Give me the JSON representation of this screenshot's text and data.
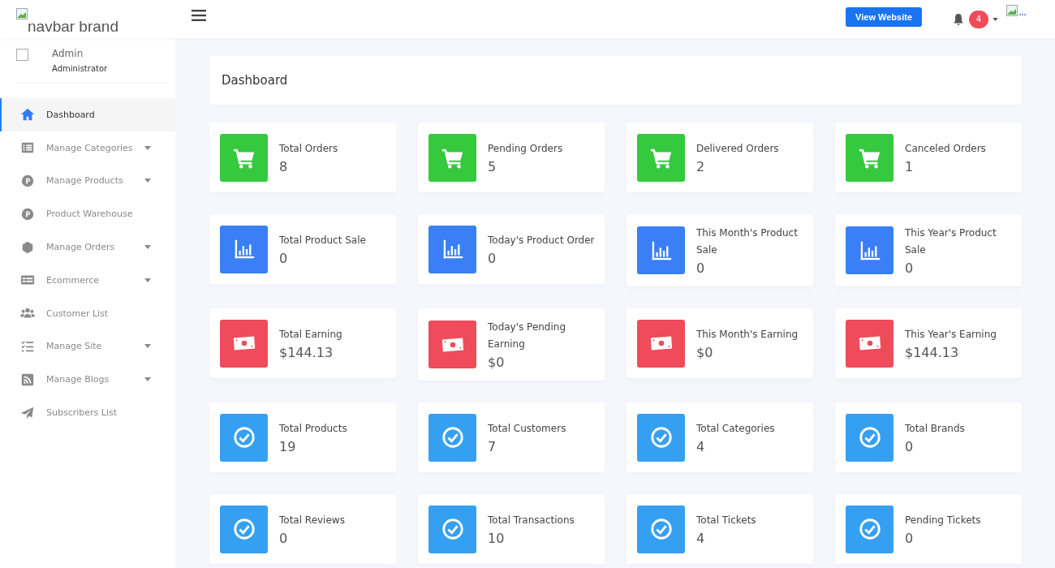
{
  "navbar": {
    "brand": "navbar brand",
    "button": "View Website",
    "notification_count": "4"
  },
  "user": {
    "name": "Admin",
    "role": "Administrator"
  },
  "sidebar": {
    "items": [
      {
        "label": "Dashboard",
        "kind": "home",
        "expandable": false,
        "selected": true
      },
      {
        "label": "Manage Categories",
        "kind": "list",
        "expandable": true,
        "selected": false
      },
      {
        "label": "Manage Products",
        "kind": "p",
        "expandable": true,
        "selected": false
      },
      {
        "label": "Product Warehouse",
        "kind": "p",
        "expandable": false,
        "selected": false
      },
      {
        "label": "Manage Orders",
        "kind": "hex",
        "expandable": true,
        "selected": false
      },
      {
        "label": "Ecommerce",
        "kind": "table",
        "expandable": true,
        "selected": false
      },
      {
        "label": "Customer List",
        "kind": "users",
        "expandable": false,
        "selected": false
      },
      {
        "label": "Manage Site",
        "kind": "tasks",
        "expandable": true,
        "selected": false
      },
      {
        "label": "Manage Blogs",
        "kind": "rss",
        "expandable": true,
        "selected": false
      },
      {
        "label": "Subscribers List",
        "kind": "send",
        "expandable": false,
        "selected": false
      }
    ]
  },
  "page_title": "Dashboard",
  "cards": [
    {
      "kind": "cart",
      "title": "Total Orders",
      "value": "8"
    },
    {
      "kind": "cart",
      "title": "Pending Orders",
      "value": "5"
    },
    {
      "kind": "cart",
      "title": "Delivered Orders",
      "value": "2"
    },
    {
      "kind": "cart",
      "title": "Canceled Orders",
      "value": "1"
    },
    {
      "kind": "chart",
      "title": "Total Product Sale",
      "value": "0"
    },
    {
      "kind": "chart",
      "title": "Today's Product Order",
      "value": "0"
    },
    {
      "kind": "chart",
      "title": "This Month's Product Sale",
      "value": "0"
    },
    {
      "kind": "chart",
      "title": "This Year's Product Sale",
      "value": "0"
    },
    {
      "kind": "money",
      "title": "Total Earning",
      "value": "$144.13"
    },
    {
      "kind": "money",
      "title": "Today's Pending Earning",
      "value": "$0"
    },
    {
      "kind": "money",
      "title": "This Month's Earning",
      "value": "$0"
    },
    {
      "kind": "money",
      "title": "This Year's Earning",
      "value": "$144.13"
    },
    {
      "kind": "check",
      "title": "Total Products",
      "value": "19"
    },
    {
      "kind": "check",
      "title": "Total Customers",
      "value": "7"
    },
    {
      "kind": "check",
      "title": "Total Categories",
      "value": "4"
    },
    {
      "kind": "check",
      "title": "Total Brands",
      "value": "0"
    },
    {
      "kind": "check",
      "title": "Total Reviews",
      "value": "0"
    },
    {
      "kind": "check",
      "title": "Total Transactions",
      "value": "10"
    },
    {
      "kind": "check",
      "title": "Total Tickets",
      "value": "4"
    },
    {
      "kind": "check",
      "title": "Pending Tickets",
      "value": "0"
    }
  ]
}
